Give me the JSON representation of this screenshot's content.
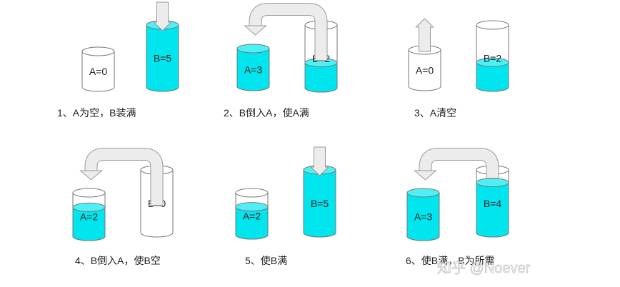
{
  "capacity": {
    "A": 3,
    "B": 5
  },
  "colors": {
    "water": "#00e5ee",
    "water_top": "#4ff0f5",
    "outline": "#777777",
    "arrow_fill": "#ececec",
    "arrow_stroke": "#9a9a9a"
  },
  "steps": [
    {
      "caption": "1、A为空，B装满",
      "A": {
        "label": "A=0",
        "value": 0
      },
      "B": {
        "label": "B=5",
        "value": 5
      },
      "arrow": "down-into-B"
    },
    {
      "caption": "2、B倒入A，使A满",
      "A": {
        "label": "A=3",
        "value": 3
      },
      "B": {
        "label": "B=2",
        "value": 2
      },
      "arrow": "pour-B-to-A"
    },
    {
      "caption": "3、A清空",
      "A": {
        "label": "A=0",
        "value": 0
      },
      "B": {
        "label": "B=2",
        "value": 2
      },
      "arrow": "up-from-A"
    },
    {
      "caption": "4、B倒入A，使B空",
      "A": {
        "label": "A=2",
        "value": 2
      },
      "B": {
        "label": "B=0",
        "value": 0
      },
      "arrow": "pour-B-to-A"
    },
    {
      "caption": "5、使B满",
      "A": {
        "label": "A=2",
        "value": 2
      },
      "B": {
        "label": "B=5",
        "value": 5
      },
      "arrow": "down-into-B"
    },
    {
      "caption": "6、使B满，B为所需",
      "A": {
        "label": "A=3",
        "value": 3
      },
      "B": {
        "label": "B=4",
        "value": 4
      },
      "arrow": "pour-B-to-A"
    }
  ],
  "watermark": "知乎 @Noever"
}
